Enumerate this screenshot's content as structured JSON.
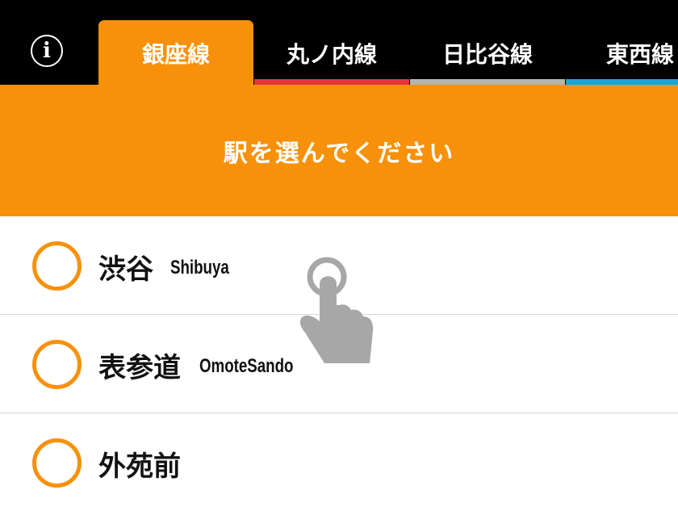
{
  "header": {
    "info_icon": "info-icon",
    "info_glyph": "i",
    "tabs": [
      {
        "label": "銀座線",
        "line_color": "#f7910a",
        "active": true
      },
      {
        "label": "丸ノ内線",
        "line_color": "#e8353a",
        "active": false
      },
      {
        "label": "日比谷線",
        "line_color": "#b5b5ac",
        "active": false
      },
      {
        "label": "東西線",
        "line_color": "#1ba4d3",
        "active": false
      }
    ]
  },
  "banner": {
    "text": "駅を選んでください"
  },
  "stations": [
    {
      "name_jp": "渋谷",
      "name_en": "Shibuya"
    },
    {
      "name_jp": "表参道",
      "name_en": "OmoteSando"
    },
    {
      "name_jp": "外苑前",
      "name_en": ""
    }
  ],
  "colors": {
    "accent": "#f7910a",
    "topbar": "#000000",
    "divider": "#d8d8d8"
  },
  "overlay": {
    "icon": "tap-hand-icon"
  }
}
